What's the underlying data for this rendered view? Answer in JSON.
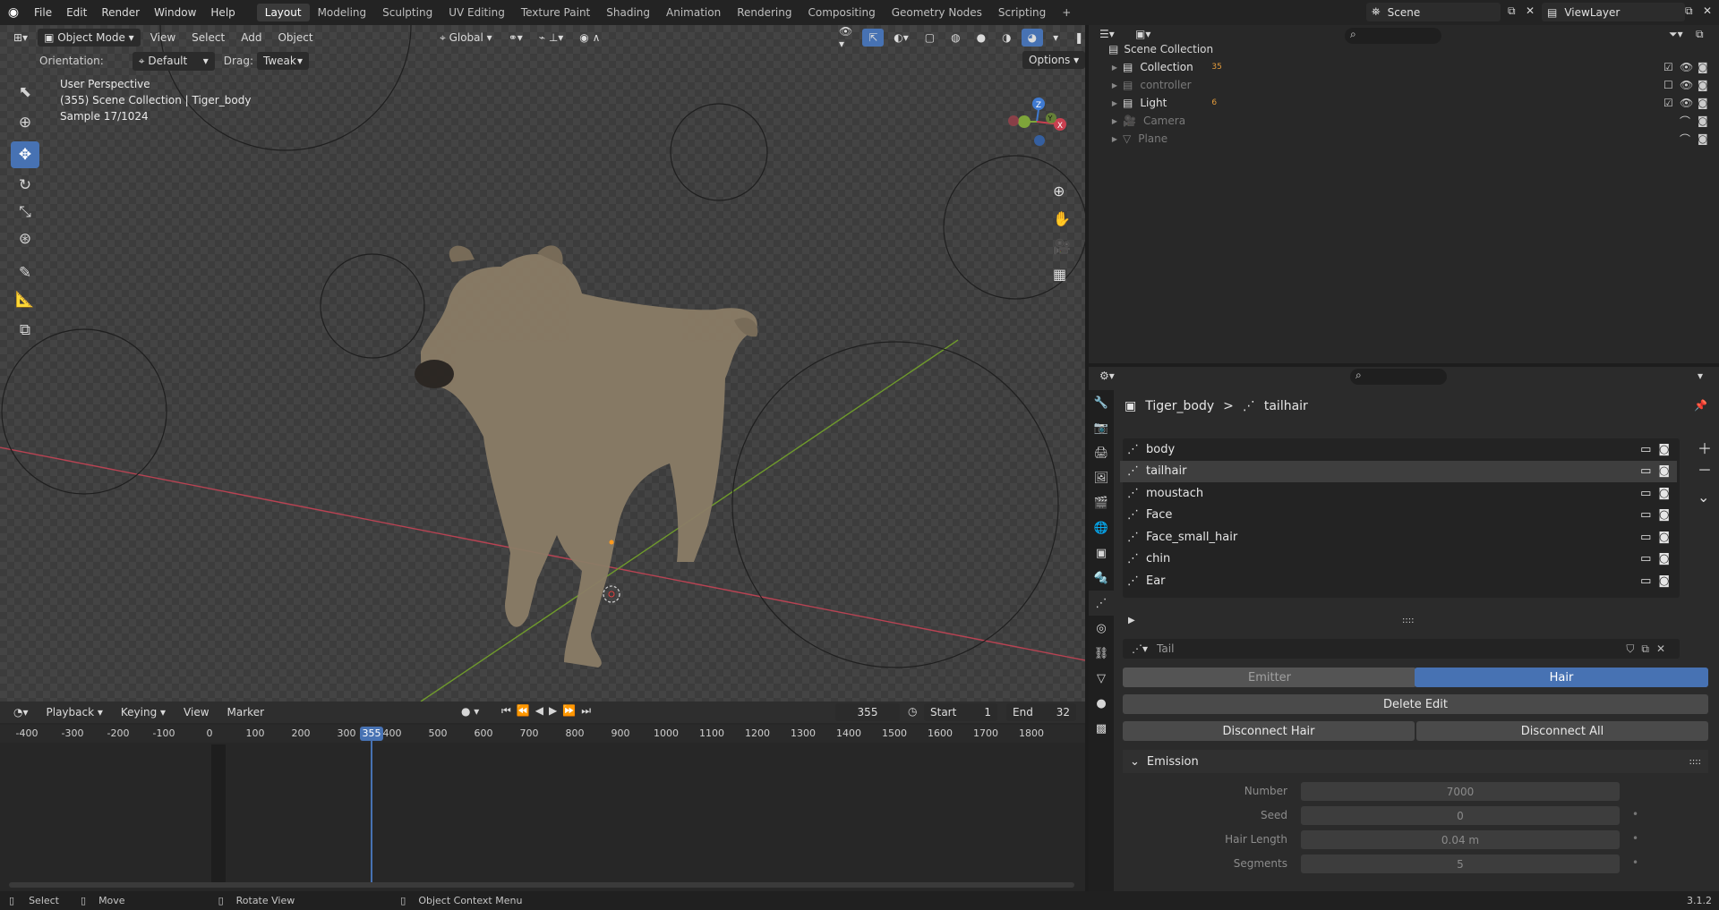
{
  "topbar": {
    "menus": [
      "File",
      "Edit",
      "Render",
      "Window",
      "Help"
    ],
    "workspaces": [
      "Layout",
      "Modeling",
      "Sculpting",
      "UV Editing",
      "Texture Paint",
      "Shading",
      "Animation",
      "Rendering",
      "Compositing",
      "Geometry Nodes",
      "Scripting"
    ],
    "active_workspace": "Layout",
    "add_tab": "+",
    "scene": "Scene",
    "view_layer": "ViewLayer"
  },
  "viewport": {
    "mode": "Object Mode",
    "menus": [
      "View",
      "Select",
      "Add",
      "Object"
    ],
    "transform": "Global",
    "orientation_label": "Orientation:",
    "orientation_value": "Default",
    "drag_label": "Drag:",
    "drag_value": "Tweak",
    "options": "Options",
    "overlay_line1": "User Perspective",
    "overlay_line2": "(355) Scene Collection | Tiger_body",
    "overlay_line3": "Sample 17/1024",
    "gizmo": {
      "z": "Z",
      "y": "Y",
      "x": "X"
    }
  },
  "timeline": {
    "menus": [
      "Playback",
      "Keying",
      "View",
      "Marker"
    ],
    "current_frame": "355",
    "start_label": "Start",
    "start": "1",
    "end_label": "End",
    "end": "32",
    "ruler": [
      "-400",
      "-300",
      "-200",
      "-100",
      "0",
      "100",
      "200",
      "300",
      "400",
      "500",
      "600",
      "700",
      "800",
      "900",
      "1000",
      "1100",
      "1200",
      "1300",
      "1400",
      "1500",
      "1600",
      "1700",
      "1800"
    ]
  },
  "statusbar": {
    "select": "Select",
    "move": "Move",
    "rotate": "Rotate View",
    "context": "Object Context Menu",
    "version": "3.1.2"
  },
  "outliner": {
    "root": "Scene Collection",
    "rows": [
      {
        "label": "Collection",
        "dim": false,
        "badge": "35"
      },
      {
        "label": "controller",
        "dim": true,
        "badge": ""
      },
      {
        "label": "Light",
        "dim": false,
        "badge": "6"
      },
      {
        "label": "Camera",
        "dim": true,
        "badge": ""
      },
      {
        "label": "Plane",
        "dim": true,
        "badge": ""
      }
    ]
  },
  "properties": {
    "breadcrumb_object": "Tiger_body",
    "breadcrumb_sep": ">",
    "breadcrumb_system": "tailhair",
    "systems": [
      "body",
      "tailhair",
      "moustach",
      "Face",
      "Face_small_hair",
      "chin",
      "Ear"
    ],
    "selected_system": "tailhair",
    "settings_name": "Tail",
    "type_emitter": "Emitter",
    "type_hair": "Hair",
    "delete_edit": "Delete Edit",
    "disconnect_hair": "Disconnect Hair",
    "disconnect_all": "Disconnect All",
    "emission": {
      "title": "Emission",
      "fields": [
        {
          "label": "Number",
          "value": "7000"
        },
        {
          "label": "Seed",
          "value": "0"
        },
        {
          "label": "Hair Length",
          "value": "0.04 m"
        },
        {
          "label": "Segments",
          "value": "5"
        }
      ]
    }
  },
  "colors": {
    "accent": "#4772b3",
    "selected_workspace": "#3a3a3a",
    "x_axis": "#c94050",
    "y_axis": "#7ea53a",
    "z_axis": "#3f7ad1"
  }
}
